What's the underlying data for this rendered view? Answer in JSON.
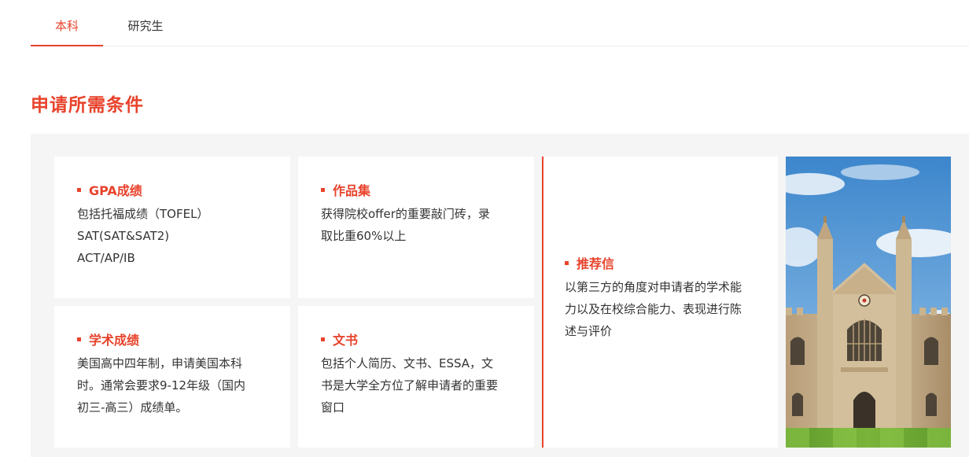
{
  "tabs": [
    {
      "label": "本科",
      "active": true
    },
    {
      "label": "研究生",
      "active": false
    }
  ],
  "section_title": "申请所需条件",
  "accent_color": "#e8432c",
  "cards": {
    "gpa": {
      "title": "GPA成绩",
      "lines": [
        "包括托福成绩（TOFEL）",
        "SAT(SAT&SAT2)",
        "ACT/AP/IB"
      ]
    },
    "works": {
      "title": "作品集",
      "lines": [
        "获得院校offer的重要敲门砖，录",
        "取比重60%以上"
      ]
    },
    "academic": {
      "title": "学术成绩",
      "lines": [
        "美国高中四年制，申请美国本科",
        "时。通常会要求9-12年级（国内",
        "初三-高三）成绩单。"
      ]
    },
    "essay": {
      "title": "文书",
      "lines": [
        "包括个人简历、文书、ESSA，文",
        "书是大学全方位了解申请者的重要",
        "窗口"
      ]
    },
    "recommendation": {
      "title": "推荐信",
      "lines": [
        "以第三方的角度对申请者的学术能",
        "力以及在校综合能力、表现进行陈",
        "述与评价"
      ]
    }
  },
  "image": {
    "subject": "gothic-college-building-photo"
  }
}
